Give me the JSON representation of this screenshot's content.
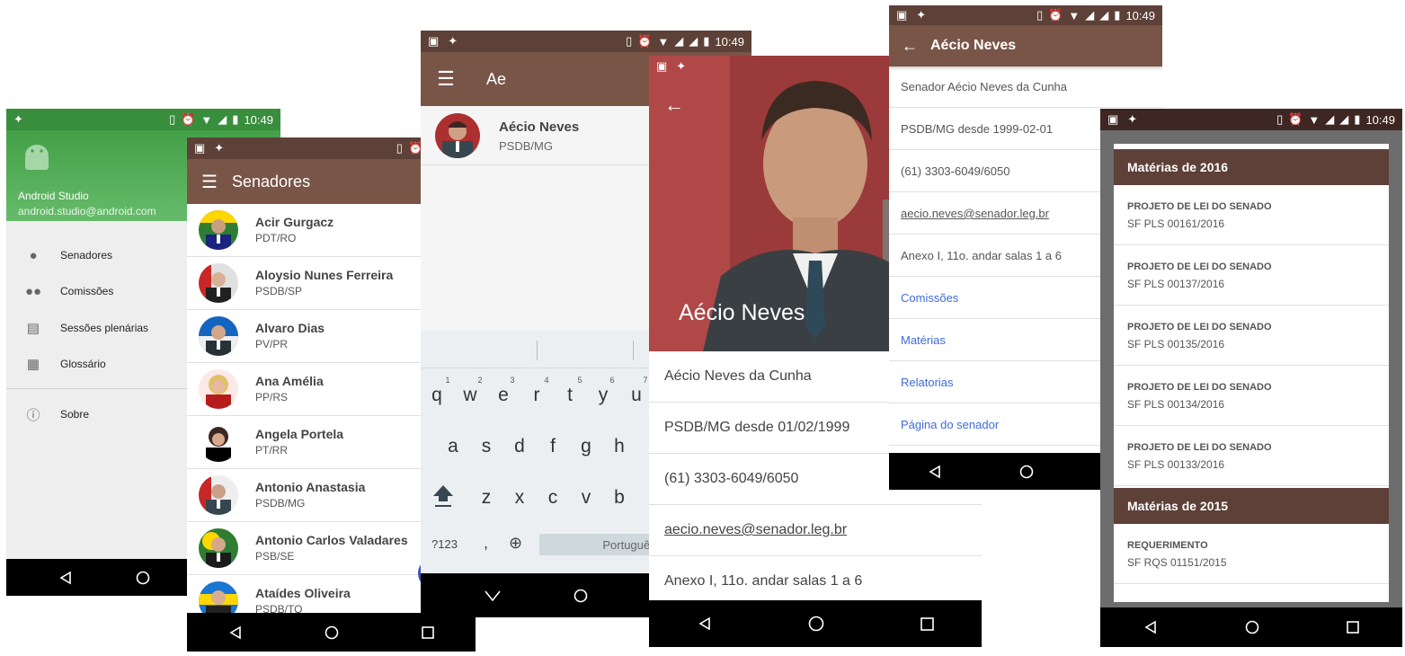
{
  "status_time": "10:49",
  "drawer": {
    "app_name": "Android Studio",
    "app_email": "android.studio@android.com",
    "items": [
      {
        "label": "Senadores",
        "icon": "person-icon"
      },
      {
        "label": "Comissões",
        "icon": "group-icon"
      },
      {
        "label": "Sessões plenárias",
        "icon": "chart-icon"
      },
      {
        "label": "Glossário",
        "icon": "book-icon"
      },
      {
        "label": "Sobre",
        "icon": "info-icon"
      }
    ]
  },
  "senators_list": {
    "title": "Senadores",
    "rows": [
      {
        "name": "Acir Gurgacz",
        "party": "PDT/RO"
      },
      {
        "name": "Aloysio Nunes Ferreira",
        "party": "PSDB/SP"
      },
      {
        "name": "Alvaro Dias",
        "party": "PV/PR"
      },
      {
        "name": "Ana Amélia",
        "party": "PP/RS"
      },
      {
        "name": "Angela Portela",
        "party": "PT/RR"
      },
      {
        "name": "Antonio Anastasia",
        "party": "PSDB/MG"
      },
      {
        "name": "Antonio Carlos Valadares",
        "party": "PSB/SE"
      },
      {
        "name": "Ataídes Oliveira",
        "party": "PSDB/TO"
      }
    ]
  },
  "search": {
    "query": "Ae",
    "result": {
      "name": "Aécio Neves",
      "party": "PSDB/MG"
    },
    "keyboard": {
      "row1": [
        "q",
        "w",
        "e",
        "r",
        "t",
        "y",
        "u"
      ],
      "row1_nums": [
        "1",
        "2",
        "3",
        "4",
        "5",
        "6",
        "7"
      ],
      "row2": [
        "a",
        "s",
        "d",
        "f",
        "g",
        "h"
      ],
      "row3": [
        "z",
        "x",
        "c",
        "v",
        "b"
      ],
      "symbols_key": "?123",
      "comma_key": ",",
      "space_label": "Português"
    }
  },
  "profile_hero": {
    "name": "Aécio Neves",
    "full_name": "Aécio Neves da Cunha",
    "party_since": "PSDB/MG desde 01/02/1999",
    "phone": "(61) 3303-6049/6050",
    "email": "aecio.neves@senador.leg.br",
    "office": "Anexo I, 11o. andar salas 1 a 6"
  },
  "profile_details": {
    "title": "Aécio Neves",
    "full_name": "Senador Aécio Neves da Cunha",
    "party_since": "PSDB/MG desde 1999-02-01",
    "phone": "(61) 3303-6049/6050",
    "email": "aecio.neves@senador.leg.br",
    "office": "Anexo I, 11o. andar salas 1 a 6",
    "links": [
      "Comissões",
      "Matérias",
      "Relatorias",
      "Página do senador"
    ]
  },
  "materias": {
    "sections": [
      {
        "title": "Matérias de 2016",
        "items": [
          {
            "type": "PROJETO DE LEI DO SENADO",
            "code": "SF PLS 00161/2016"
          },
          {
            "type": "PROJETO DE LEI DO SENADO",
            "code": "SF PLS 00137/2016"
          },
          {
            "type": "PROJETO DE LEI DO SENADO",
            "code": "SF PLS 00135/2016"
          },
          {
            "type": "PROJETO DE LEI DO SENADO",
            "code": "SF PLS 00134/2016"
          },
          {
            "type": "PROJETO DE LEI DO SENADO",
            "code": "SF PLS 00133/2016"
          }
        ]
      },
      {
        "title": "Matérias de 2015",
        "items": [
          {
            "type": "REQUERIMENTO",
            "code": "SF RQS 01151/2015"
          }
        ]
      }
    ]
  },
  "colors": {
    "primary": "#795548",
    "primary_dark": "#5d4037",
    "drawer_green": "#43a047",
    "link_blue": "#3f6ad8"
  }
}
